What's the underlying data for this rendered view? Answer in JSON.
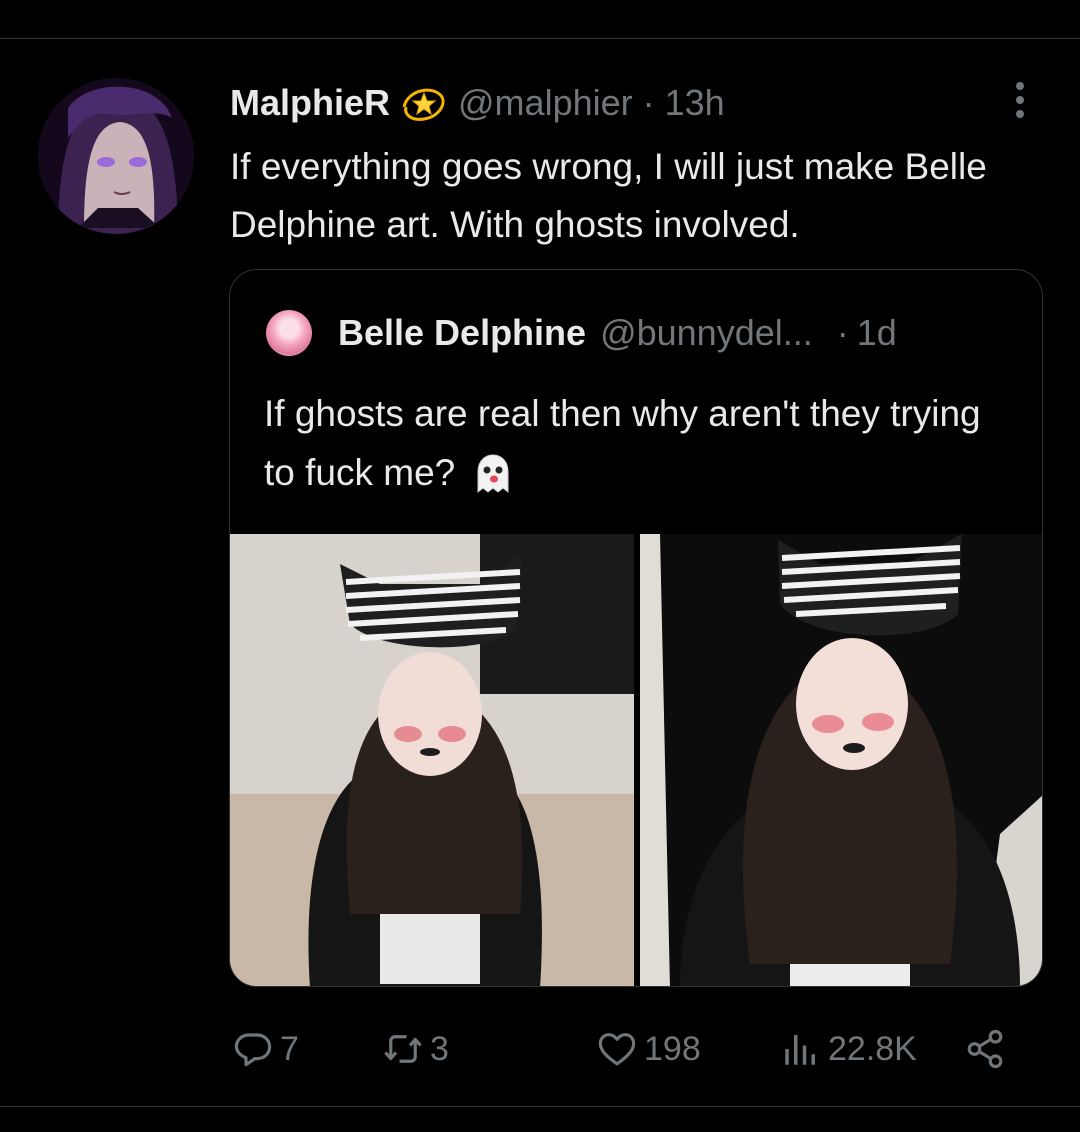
{
  "tweet": {
    "display_name": "MalphieR",
    "handle": "@malphier",
    "separator": "·",
    "time": "13h",
    "text": "If everything goes wrong, I will just make Belle Delphine art. With ghosts involved."
  },
  "quoted": {
    "display_name": "Belle Delphine",
    "handle": "@bunnydel...",
    "separator": "·",
    "time": "1d",
    "text": "If ghosts are real then why aren't they trying to fuck me?"
  },
  "actions": {
    "replies": "7",
    "retweets": "3",
    "likes": "198",
    "views": "22.8K"
  },
  "icons": {
    "verified": "dizzy-star-icon",
    "more": "more-vertical-icon",
    "emoji": "ghost-emoji-icon",
    "reply": "reply-icon",
    "retweet": "retweet-icon",
    "like": "heart-icon",
    "views": "views-bar-chart-icon",
    "share": "share-icon"
  },
  "colors": {
    "background": "#000000",
    "text": "#e7e9ea",
    "secondary": "#71767b",
    "border": "#2f3336"
  }
}
